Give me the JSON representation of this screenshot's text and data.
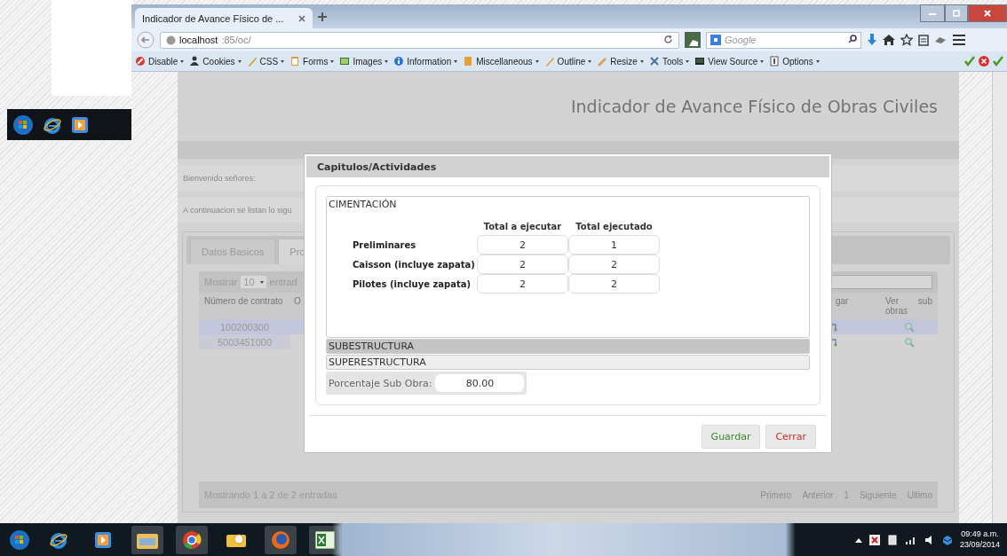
{
  "browser": {
    "tabs": [
      {
        "label": "Indicador de Avance Físico de ...",
        "selected": true
      }
    ],
    "address": {
      "host": "localhost",
      "path": ":85/oc/"
    },
    "search": {
      "placeholder": "Google"
    },
    "dev_toolbar": [
      "Disable",
      "Cookies",
      "CSS",
      "Forms",
      "Images",
      "Information",
      "Miscellaneous",
      "Outline",
      "Resize",
      "Tools",
      "View Source",
      "Options"
    ]
  },
  "page": {
    "title": "Indicador de Avance Físico de Obras Civiles",
    "welcome": "Bienvenido señores:",
    "intro": "A continuacion se listan lo sigu",
    "tabs": [
      {
        "label": "Datos Basicos",
        "selected": false
      },
      {
        "label": "Pro",
        "selected": true
      }
    ],
    "table": {
      "length_label": "Mostrar",
      "length_value": "10",
      "length_suffix": "entrad",
      "columns": [
        "Número de contrato",
        "O",
        "gar",
        "Ver sub obras"
      ],
      "rows": [
        {
          "contract": "100200300",
          "selected": true
        },
        {
          "contract": "5003451000",
          "selected": false
        }
      ],
      "info": "Mostrando 1 a 2 de 2 entradas",
      "pagination": [
        "Primero",
        "Anterior",
        "1",
        "Siguiente",
        "Ultimo"
      ]
    }
  },
  "dialog": {
    "title": "Capitulos/Actividades",
    "sections": [
      {
        "title": "CIMENTACIÓN",
        "expanded": true,
        "columns": [
          "Total a ejecutar",
          "Total ejecutado"
        ],
        "rows": [
          {
            "label": "Preliminares",
            "planned": "2",
            "done": "1"
          },
          {
            "label": "Caisson (incluye zapata)",
            "planned": "2",
            "done": "2"
          },
          {
            "label": "Pilotes (incluye zapata)",
            "planned": "2",
            "done": "2"
          }
        ]
      },
      {
        "title": "SUBESTRUCTURA",
        "expanded": false,
        "highlighted": true
      },
      {
        "title": "SUPERESTRUCTURA",
        "expanded": false,
        "highlighted": false
      }
    ],
    "percent": {
      "label": "Porcentaje Sub Obra:",
      "value": "80.00"
    },
    "buttons": [
      {
        "label": "Guardar",
        "kind": "save"
      },
      {
        "label": "Cerrar",
        "kind": "close"
      }
    ]
  },
  "taskbar": {
    "time": "09:49 a.m.",
    "date": "23/09/2014"
  }
}
